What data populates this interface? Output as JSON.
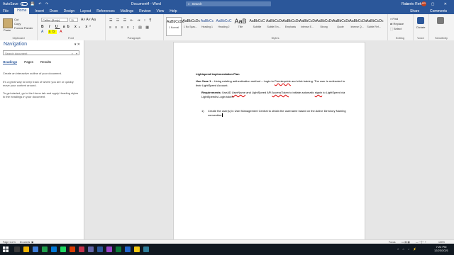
{
  "titlebar": {
    "autosave": "AutoSave",
    "toggle_state": "Off",
    "document_title": "Document4 - Word",
    "search_placeholder": "Search",
    "user": "Roberto Rolvez",
    "avatar_initials": "RR"
  },
  "menu": {
    "tabs": [
      "File",
      "Home",
      "Insert",
      "Draw",
      "Design",
      "Layout",
      "References",
      "Mailings",
      "Review",
      "View",
      "Help"
    ],
    "active_tab": "Home",
    "share": "Share",
    "comments": "Comments"
  },
  "ribbon": {
    "clipboard": {
      "paste": "Paste",
      "cut": "Cut",
      "copy": "Copy",
      "format_painter": "Format Painter",
      "label": "Clipboard"
    },
    "font": {
      "family": "Calibri (Body)",
      "size": "11",
      "label": "Font"
    },
    "paragraph": {
      "label": "Paragraph"
    },
    "styles": {
      "label": "Styles",
      "items": [
        {
          "sample": "AaBbCcDc",
          "name": "1 Normal"
        },
        {
          "sample": "AaBbCcDc",
          "name": "1 No Spac..."
        },
        {
          "sample": "AaBbCc",
          "name": "Heading 1"
        },
        {
          "sample": "AaBbCcC",
          "name": "Heading 2"
        },
        {
          "sample": "AaB",
          "name": "Title"
        },
        {
          "sample": "AaBbCcC",
          "name": "Subtitle"
        },
        {
          "sample": "AaBbCcDc",
          "name": "Subtle Em..."
        },
        {
          "sample": "AaBbCcDc",
          "name": "Emphasis"
        },
        {
          "sample": "AaBbCcDc",
          "name": "Intense E..."
        },
        {
          "sample": "AaBbCcDc",
          "name": "Strong"
        },
        {
          "sample": "AaBbCcDc",
          "name": "Quote"
        },
        {
          "sample": "AaBbCcDc",
          "name": "Intense Q..."
        },
        {
          "sample": "AaBbCcDc",
          "name": "Subtle Ref..."
        }
      ]
    },
    "editing": {
      "find": "Find",
      "replace": "Replace",
      "select": "Select",
      "label": "Editing"
    },
    "voice": {
      "dictate": "Dictate",
      "label": "Voice"
    },
    "sensitivity": {
      "label": "Sensitivity"
    }
  },
  "navigation": {
    "title": "Navigation",
    "search_placeholder": "Search document",
    "tabs": [
      "Headings",
      "Pages",
      "Results"
    ],
    "active_tab": "Headings",
    "paragraphs": [
      "Create an interactive outline of your document.",
      "It's a great way to keep track of where you are or quickly move your content around.",
      "To get started, go to the Home tab and apply Heading styles to the headings in your document."
    ]
  },
  "document": {
    "heading": "Lightspeed Implementation Plan",
    "use_case_label": "Use Case 1",
    "use_case_text_1": " – Using existing authentication method – Login to ",
    "use_case_link": "Premierpride",
    "use_case_text_2": " and click training. The user is redirected to their LightSpeed Account.",
    "requirements_label": "Requirements:",
    "req_text_1": " UseAD ",
    "req_username": "UserName",
    "req_text_2": " and LightSpeed API ",
    "req_access_token": "AccessToken",
    "req_text_3": " to initiate automatic ",
    "req_signin": "signin",
    "req_text_4": " to LightSpeed via LightSpeed's Login token.",
    "list_number": "1)",
    "list_item": "Create the user(s) in User Management Central to obtain the username based on the Active Directory Naming convention."
  },
  "status": {
    "page": "Page 1 of 1",
    "words": "81 words",
    "focus": "Focus",
    "zoom": "100%"
  },
  "taskbar": {
    "time": "7:22 PM",
    "date": "12/23/2021"
  }
}
